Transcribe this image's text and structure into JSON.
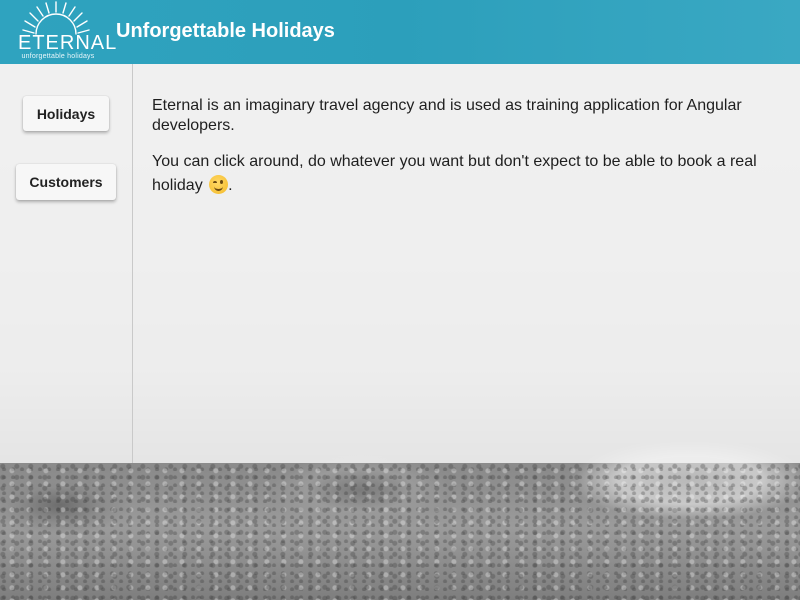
{
  "header": {
    "logo_word": "ETERNAL",
    "logo_tagline": "unforgettable holidays",
    "title": "Unforgettable Holidays",
    "background_color": "#2fa3bf"
  },
  "sidebar": {
    "items": [
      {
        "label": "Holidays"
      },
      {
        "label": "Customers"
      }
    ]
  },
  "main": {
    "paragraph_1": "Eternal is an imaginary travel agency and is used as training application for Angular developers.",
    "paragraph_2": "You can click around, do whatever you want but don't expect to be able to book a real holiday",
    "paragraph_2_end": ".",
    "emoji": "wink-face-icon"
  }
}
